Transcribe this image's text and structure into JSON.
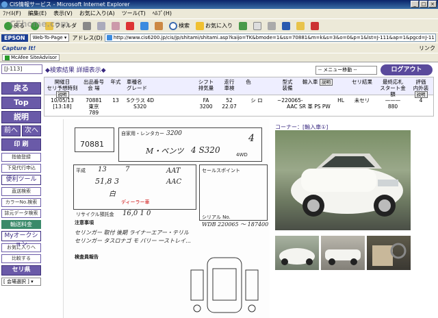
{
  "window": {
    "title": "CIS情報サービス - Microsoft Internet Explorer"
  },
  "menubar": [
    "ﾌｧｲﾙ(F)",
    "編集(E)",
    "表示(V)",
    "お気に入り(A)",
    "ツール(T)",
    "ﾍﾙﾌﾟ(H)"
  ],
  "toolbar": {
    "back": "戻る",
    "folder": "フォルダ",
    "search": "検索",
    "favorites": "お気に入り",
    "watermark": "CEhome.com"
  },
  "addressbar": {
    "epson": "EPSON",
    "webtopage": "Web-To-Page ▾",
    "address_label": "アドレス(D)",
    "url": "http://www.cis6200.jp/cis/jp/shitami/shitami.asp?kaijo=TK&bmode=1&ss=70881&m=k&s=3&o=0&p=1&lst=J-111&ap=1&pgcd=J-11"
  },
  "capturebar": {
    "capture": "Capture It!",
    "link": "リンク"
  },
  "mcafeebar": {
    "label": "McAfee SiteAdvisor"
  },
  "header": {
    "id": "[J-113]",
    "breadcrumb": "◆検索結果  詳細表示◆",
    "menu_select": "-- メニュー移動 --",
    "logout": "ログアウト"
  },
  "sidebar": {
    "back": "戻る",
    "top": "Top",
    "desc": "説明",
    "prev": "前へ",
    "next": "次へ",
    "print": "印 刷",
    "register": "指値登録",
    "lower_register": "下見代行申込",
    "tools": "便利ツール",
    "direct_search": "直送検索",
    "color_search": "カラーNo.検索",
    "reprint": "誌元データ検索",
    "express": "輸送料金",
    "myauction": "Myオークション",
    "favorites_add": "お気に入りへ",
    "compare": "比較する",
    "seri": "セリ県",
    "venue_select": "[ 会場選択 ] ▾"
  },
  "table": {
    "headers": {
      "date": "開催日",
      "date2": "セリ予想時刻",
      "lot": "出品番号",
      "venue": "会 場",
      "year": "年式",
      "model": "車種名",
      "grade": "グレード",
      "shift": "シフト",
      "disp": "排気量",
      "mileage": "走行",
      "inspect": "車検",
      "color": "色",
      "type": "型式",
      "equip": "装備",
      "import": "輸入車",
      "result": "セリ結果",
      "start": "最終応札",
      "start2": "スタート金額",
      "score": "評価",
      "score2": "内外装",
      "help": "説明"
    },
    "row": {
      "date": "10/05/13",
      "time": "[13:18]",
      "lot": "70881",
      "venue": "東京",
      "lot_sub": "789",
      "year": "13",
      "model": "Sクラス  4D",
      "grade": "S320",
      "shift": "FA",
      "disp": "3200",
      "mileage": "52",
      "inspect": "22.07",
      "color": "シ ロ",
      "type": "~220065-",
      "equip": "AAC SR 革 PS PW",
      "import": "HL",
      "result": "未セリ",
      "bid": "———",
      "start": "880",
      "score": "4"
    },
    "corner_link": "コーナー：[輸入車①]"
  },
  "sheet": {
    "lot": "70881",
    "lot_handwritten": "70881",
    "maker_label": "自家用・レンタカー",
    "owner": "M・ベンツ",
    "model": "4 S320",
    "cc": "3200",
    "drive": "4WD",
    "year_label": "平成",
    "year": "13",
    "month": "7",
    "mileage": "51,8 3",
    "color": "白",
    "shift": "AAT",
    "ac": "AAC",
    "score": "4",
    "recycle_label": "リサイクル預託金",
    "recycle": "16,0 1 0",
    "chassis_label": "シリアル No.",
    "chassis": "WDB 220065 ～ 187400",
    "dealer_label": "ディーラー車",
    "notes_title": "注意事項",
    "note1": "セリンガー 取付 後期 ライナーエアー・テリル",
    "note2": "セリンガー タスロナゴ モ バリー 一ストレイ...",
    "inspection_title": "検査員報告",
    "sales_points_label": "セールスポイント"
  },
  "photos": {
    "main": "front-left view",
    "thumbs": [
      "rear-left view",
      "side view",
      "interior view"
    ]
  }
}
